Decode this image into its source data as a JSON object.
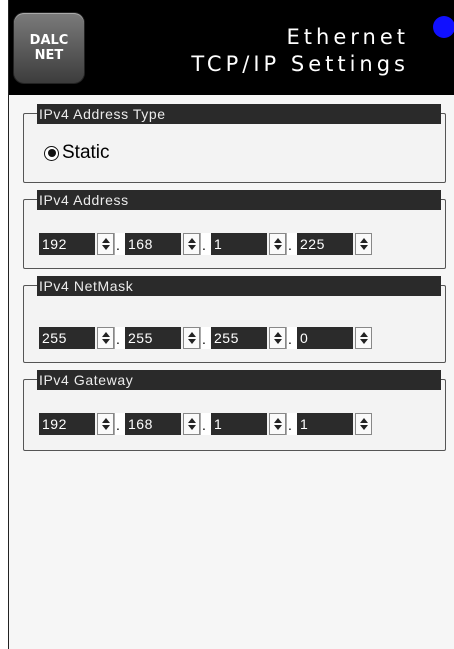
{
  "header": {
    "logo_text": "DALC\nNET",
    "title_line1": "Ethernet",
    "title_line2": "TCP/IP Settings",
    "status_dot_color": "#1010ff"
  },
  "address_type": {
    "legend": "IPv4 Address Type",
    "options": [
      {
        "label": "Static",
        "selected": true
      }
    ]
  },
  "ipv4_address": {
    "legend": "IPv4 Address",
    "octets": [
      "192",
      "168",
      "1",
      "225"
    ],
    "separator": "."
  },
  "ipv4_netmask": {
    "legend": "IPv4 NetMask",
    "octets": [
      "255",
      "255",
      "255",
      "0"
    ],
    "separator": "."
  },
  "ipv4_gateway": {
    "legend": "IPv4 Gateway",
    "octets": [
      "192",
      "168",
      "1",
      "1"
    ],
    "separator": "."
  }
}
